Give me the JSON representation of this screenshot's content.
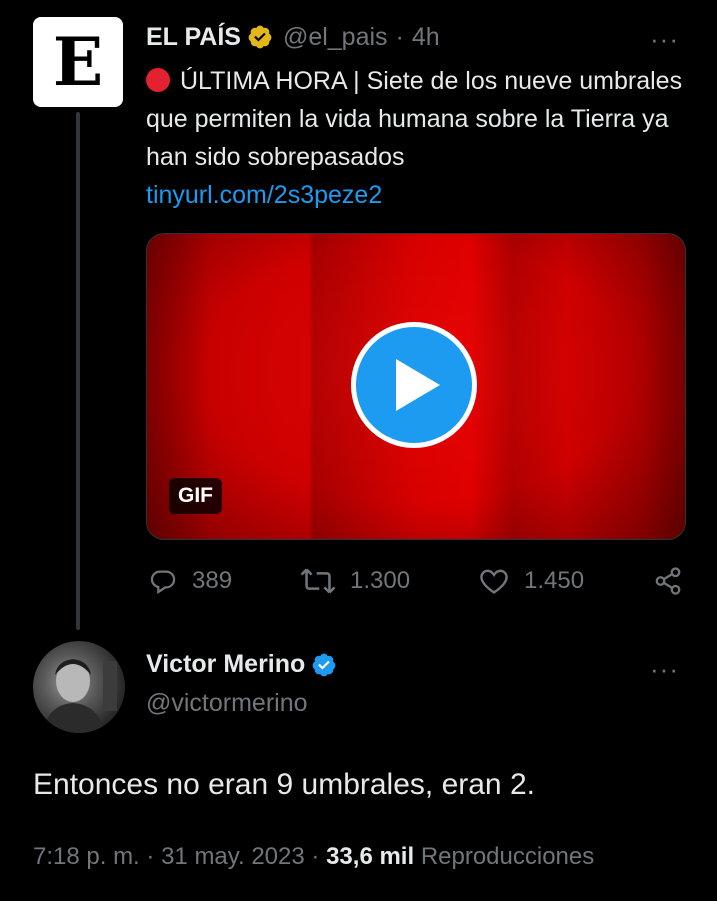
{
  "tweet": {
    "author_name": "EL PAÍS",
    "logo_letter": "E",
    "handle": "@el_pais",
    "separator": "·",
    "time": "4h",
    "more": "···",
    "text_main": "ÚLTIMA HORA | Siete de los nueve umbrales que permiten la vida humana sobre la Tierra ya han sido sobrepasados",
    "link": "tinyurl.com/2s3peze2",
    "media_badge": "GIF",
    "replies": "389",
    "retweets": "1.300",
    "likes": "1.450"
  },
  "reply": {
    "author_name": "Victor Merino",
    "handle": "@victormerino",
    "more": "···",
    "text": "Entonces no eran 9 umbrales, eran 2.",
    "time": "7:18 p. m.",
    "sep1": "·",
    "date": "31 may. 2023",
    "sep2": "·",
    "views_count": "33,6 mil",
    "views_label": "Reproducciones"
  },
  "colors": {
    "accent": "#1d9bf0",
    "gold_badge": "#e2b719",
    "muted": "#71767b",
    "live_dot": "#e3212f"
  },
  "icons": [
    "reply-icon",
    "retweet-icon",
    "like-icon",
    "share-icon",
    "verified-gold-icon",
    "verified-blue-icon",
    "play-icon"
  ]
}
